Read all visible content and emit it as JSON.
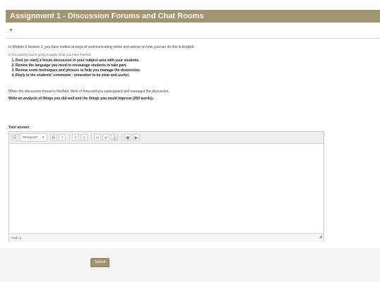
{
  "assignment": {
    "title": "Assignment 1 - Discussion Forums and Chat Rooms",
    "toggle_icon": "chevron-down-icon"
  },
  "content": {
    "intro": "In Module 5 Section 2, you have looked at ways of communicating online and advice on how you can do this in English.",
    "intro2": "In this activity you're going to apply what you have learned.",
    "steps": [
      "Find (or start) a forum discussion in your subject area with your students.",
      "Review the language you need to encourage students to take part.",
      "Review some techniques and phrases to help you manage the discussion.",
      "Reply to the students' comments - remember to be clear and useful."
    ],
    "after": "When the discussion thread is finished, think of how well you participated and managed the discussion.",
    "task": "Write an analysis of things you did well and the things you could improve (250 words)."
  },
  "answer": {
    "label": "Your answer",
    "editor": {
      "format_value": "Paragraph",
      "toolbar_icons": [
        "toggle-icon",
        "bold-icon",
        "italic-icon",
        "bullet-list-icon",
        "numbered-list-icon",
        "link-icon",
        "unlink-icon",
        "image-icon",
        "media-icon"
      ],
      "status_path": "Path: p"
    }
  },
  "actions": {
    "submit_label": "Submit"
  }
}
